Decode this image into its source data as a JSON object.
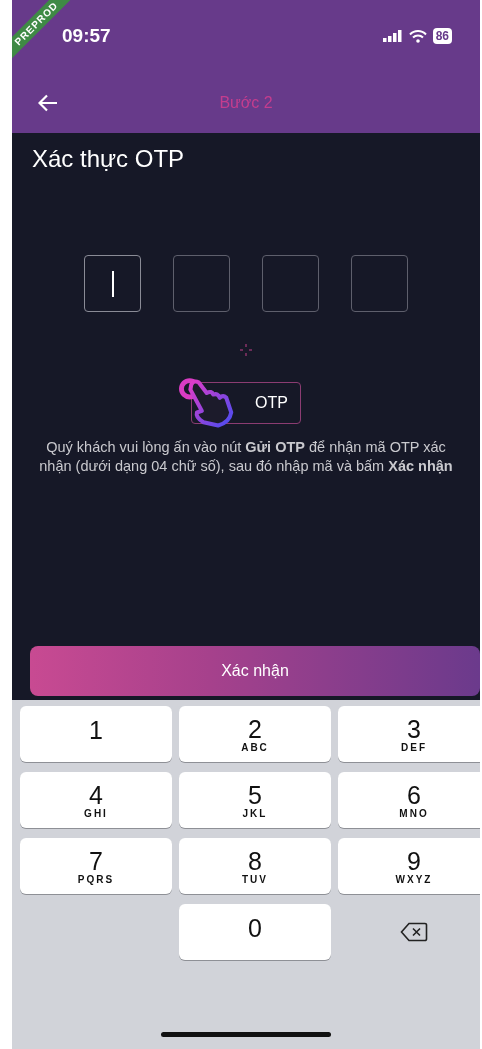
{
  "status_bar": {
    "time": "09:57",
    "battery": "86"
  },
  "debug_banner": "PREPROD",
  "header": {
    "title": "Bước 2"
  },
  "page_title": "Xác thực OTP",
  "otp_boxes": [
    {
      "focused": true
    },
    {
      "focused": false
    },
    {
      "focused": false
    },
    {
      "focused": false
    }
  ],
  "send_otp_button": {
    "label": "OTP"
  },
  "instruction": "Quý khách vui lòng ấn vào nút **Gửi OTP** để nhận mã OTP xác nhận (dưới dạng 04 chữ số), sau đó nhập mã và bấm **Xác nhận**",
  "confirm_button": {
    "label": "Xác nhận"
  },
  "keypad": [
    {
      "kind": "digit",
      "digit": "1"
    },
    {
      "kind": "digit",
      "digit": "2",
      "letters": "ABC"
    },
    {
      "kind": "digit",
      "digit": "3",
      "letters": "DEF"
    },
    {
      "kind": "digit",
      "digit": "4",
      "letters": "GHI"
    },
    {
      "kind": "digit",
      "digit": "5",
      "letters": "JKL"
    },
    {
      "kind": "digit",
      "digit": "6",
      "letters": "MNO"
    },
    {
      "kind": "digit",
      "digit": "7",
      "letters": "PQRS"
    },
    {
      "kind": "digit",
      "digit": "8",
      "letters": "TUV"
    },
    {
      "kind": "digit",
      "digit": "9",
      "letters": "WXYZ"
    },
    {
      "kind": "digit",
      "digit": "0"
    },
    {
      "kind": "delete"
    }
  ]
}
